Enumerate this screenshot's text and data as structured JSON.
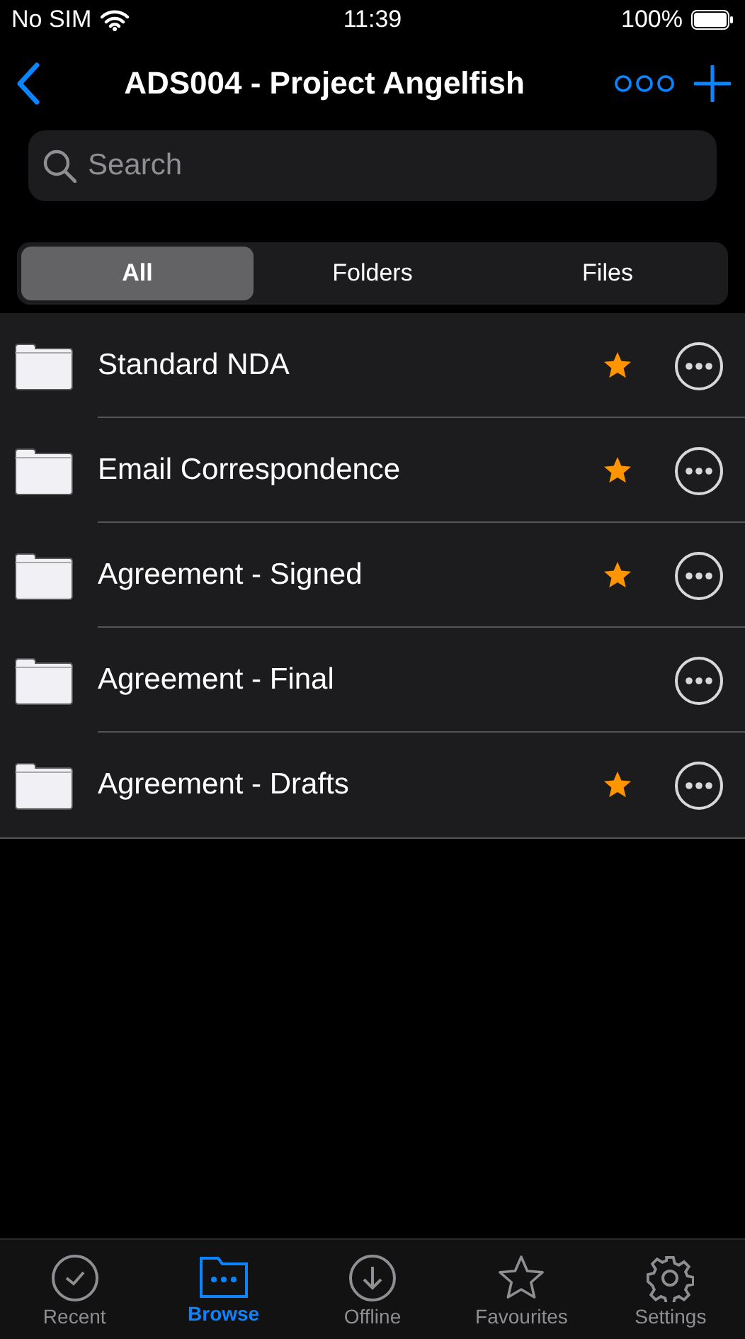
{
  "status_bar": {
    "carrier": "No SIM",
    "time": "11:39",
    "battery": "100%"
  },
  "nav": {
    "title": "ADS004 - Project Angelfish"
  },
  "search": {
    "placeholder": "Search"
  },
  "segments": [
    {
      "label": "All",
      "selected": true
    },
    {
      "label": "Folders",
      "selected": false
    },
    {
      "label": "Files",
      "selected": false
    }
  ],
  "folders": [
    {
      "name": "Standard NDA",
      "favourite": true
    },
    {
      "name": "Email Correspondence",
      "favourite": true
    },
    {
      "name": "Agreement - Signed",
      "favourite": true
    },
    {
      "name": "Agreement - Final",
      "favourite": false
    },
    {
      "name": "Agreement - Drafts",
      "favourite": true
    }
  ],
  "tab_bar": [
    {
      "label": "Recent",
      "kind": "recent",
      "selected": false
    },
    {
      "label": "Browse",
      "kind": "browse",
      "selected": true
    },
    {
      "label": "Offline",
      "kind": "offline",
      "selected": false
    },
    {
      "label": "Favourites",
      "kind": "favourites",
      "selected": false
    },
    {
      "label": "Settings",
      "kind": "settings",
      "selected": false
    }
  ]
}
